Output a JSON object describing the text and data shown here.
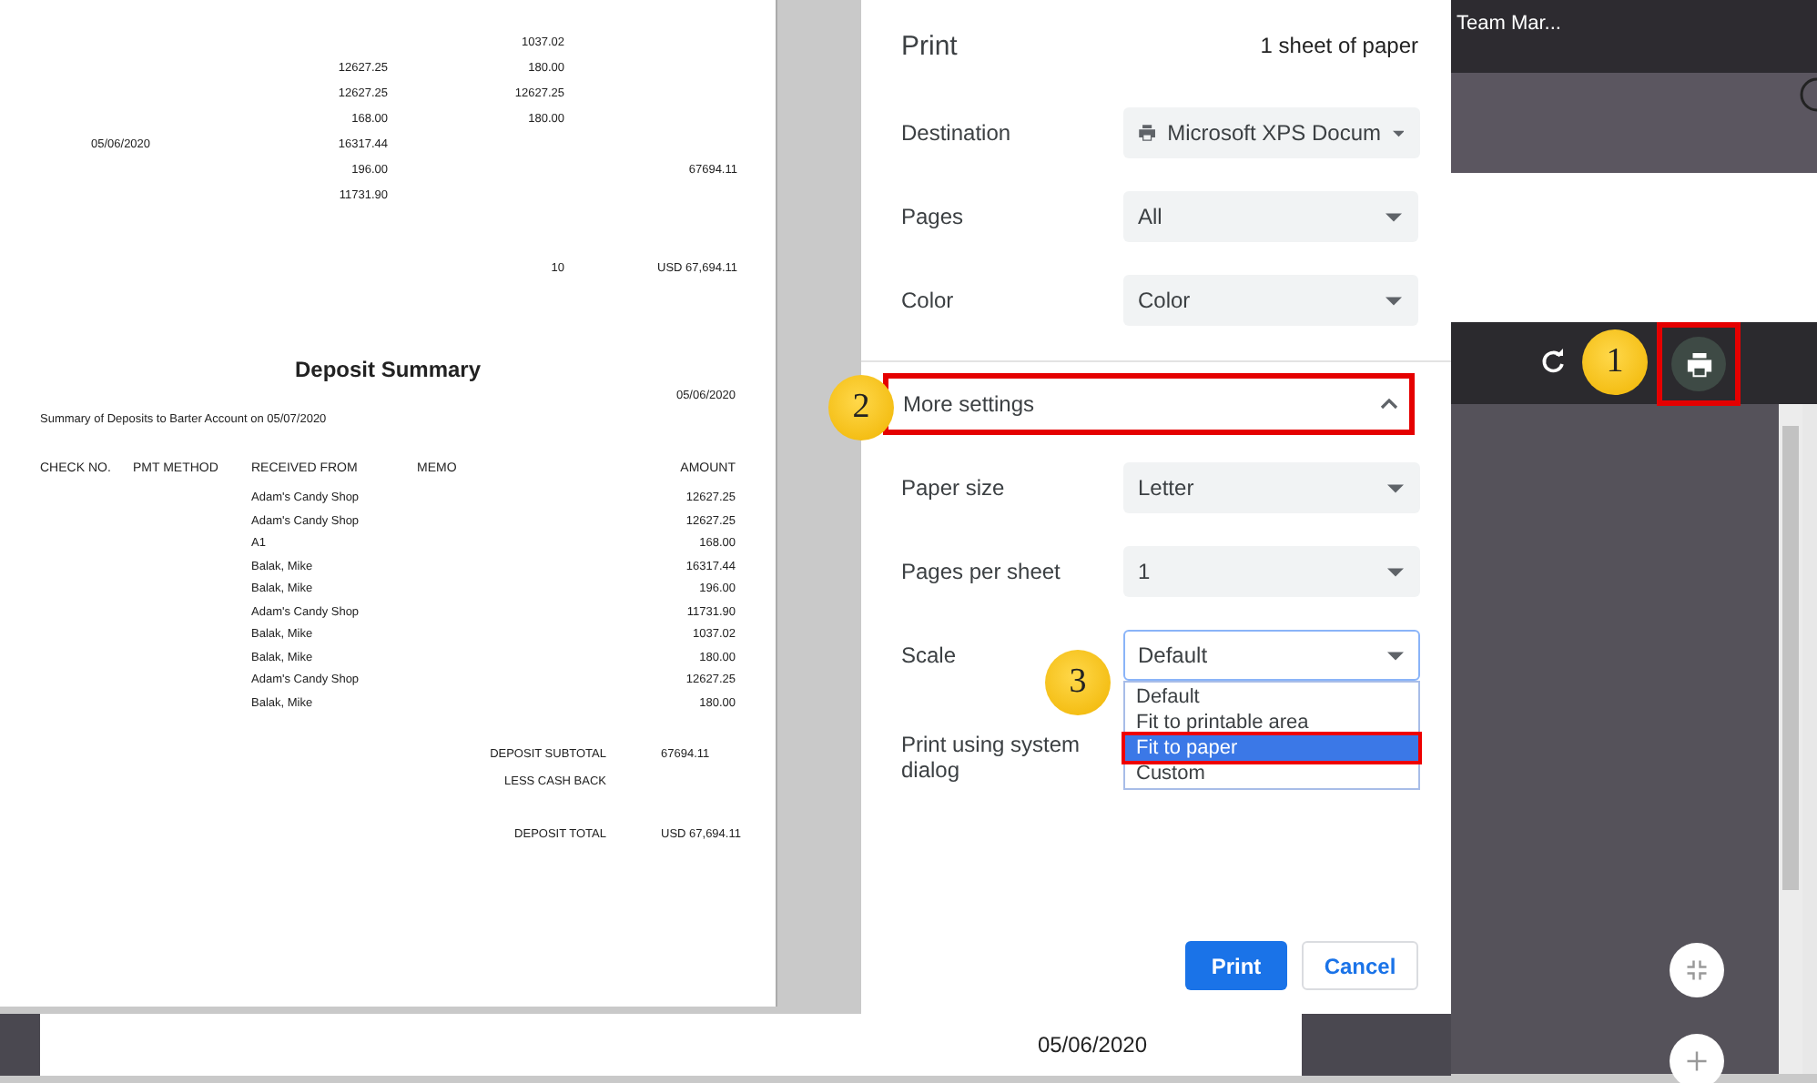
{
  "preview": {
    "top_rows": [
      {
        "column_3": "1037.02"
      },
      {
        "column_2": "12627.25",
        "column_3": "180.00"
      },
      {
        "column_2": "12627.25",
        "column_3": "12627.25"
      },
      {
        "column_2": "168.00",
        "column_3": "180.00"
      },
      {
        "column_1": "05/06/2020",
        "column_2": "16317.44"
      },
      {
        "column_2": "196.00",
        "column_4": "67694.11"
      },
      {
        "column_2": "11731.90"
      }
    ],
    "top_total": {
      "column_3": "10",
      "column_4": "USD 67,694.11"
    },
    "title": "Deposit Summary",
    "date": "05/06/2020",
    "subtitle": "Summary of Deposits to Barter Account on 05/07/2020",
    "columns": [
      "CHECK NO.",
      "PMT METHOD",
      "RECEIVED FROM",
      "MEMO",
      "AMOUNT"
    ],
    "rows": [
      {
        "received_from": "Adam's Candy Shop",
        "amount": "12627.25"
      },
      {
        "received_from": "Adam's Candy Shop",
        "amount": "12627.25"
      },
      {
        "received_from": "A1",
        "amount": "168.00"
      },
      {
        "received_from": "Balak, Mike",
        "amount": "16317.44"
      },
      {
        "received_from": "Balak, Mike",
        "amount": "196.00"
      },
      {
        "received_from": "Adam's Candy Shop",
        "amount": "11731.90"
      },
      {
        "received_from": "Balak, Mike",
        "amount": "1037.02"
      },
      {
        "received_from": "Balak, Mike",
        "amount": "180.00"
      },
      {
        "received_from": "Adam's Candy Shop",
        "amount": "12627.25"
      },
      {
        "received_from": "Balak, Mike",
        "amount": "180.00"
      }
    ],
    "totals": [
      {
        "label": "DEPOSIT SUBTOTAL",
        "value": "67694.11"
      },
      {
        "label": "LESS CASH BACK"
      },
      {
        "label": "DEPOSIT TOTAL",
        "value": "USD 67,694.11"
      }
    ]
  },
  "print_dialog": {
    "title": "Print",
    "sheet_count": "1 sheet of paper",
    "settings": [
      {
        "label": "Destination",
        "value": "Microsoft XPS Docum",
        "kind": "printer"
      },
      {
        "label": "Pages",
        "value": "All",
        "kind": "plain"
      },
      {
        "label": "Color",
        "value": "Color",
        "kind": "plain"
      }
    ],
    "more_settings": {
      "label": "More settings",
      "expanded": true
    },
    "more": [
      {
        "label": "Paper size",
        "value": "Letter",
        "focused": false
      },
      {
        "label": "Pages per sheet",
        "value": "1",
        "focused": false
      },
      {
        "label": "Scale",
        "value": "Default",
        "focused": true
      }
    ],
    "scale_options": [
      {
        "label": "Default",
        "selected": false
      },
      {
        "label": "Fit to printable area",
        "selected": false
      },
      {
        "label": "Fit to paper",
        "selected": true
      },
      {
        "label": "Custom",
        "selected": false
      }
    ],
    "system_dialog": "Print using system dialog",
    "buttons": {
      "print": "Print",
      "cancel": "Cancel"
    }
  },
  "app": {
    "tab_title": "Team Mar...",
    "date": "05/06/2020"
  },
  "annotations": [
    {
      "number": "1"
    },
    {
      "number": "2"
    },
    {
      "number": "3"
    }
  ]
}
